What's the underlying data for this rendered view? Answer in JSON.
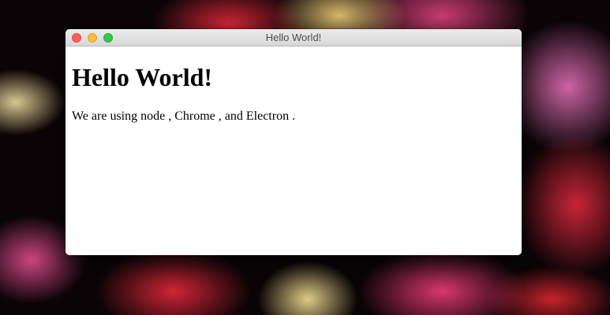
{
  "window": {
    "title": "Hello World!"
  },
  "page": {
    "heading": "Hello World!",
    "text_intro": "We are using node",
    "text_sep1": " , Chrome",
    "text_sep2": " , and Electron",
    "text_end": " ."
  },
  "colors": {
    "close": "#fc605c",
    "minimize": "#fdbc40",
    "zoom": "#34c84a"
  }
}
